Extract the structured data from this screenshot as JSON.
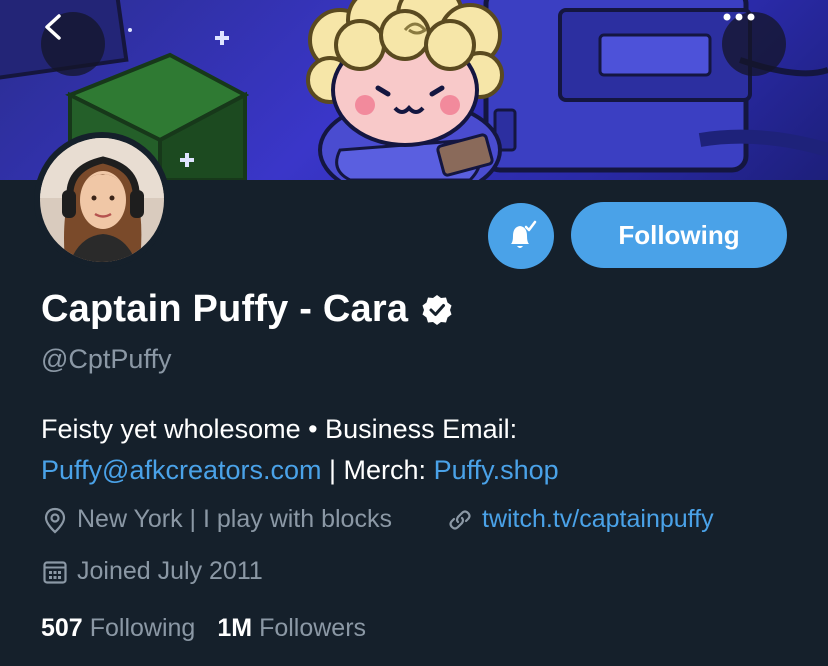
{
  "profile": {
    "name": "Captain Puffy - Cara",
    "handle": "@CptPuffy",
    "bio": {
      "line1": "Feisty yet wholesome • Business Email:",
      "email": "Puffy@afkcreators.com",
      "merch_sep": " | Merch: ",
      "merch_link": "Puffy.shop"
    },
    "location": "New York | I play with blocks",
    "website": "twitch.tv/captainpuffy",
    "joined": "Joined July 2011"
  },
  "actions": {
    "follow_label": "Following"
  },
  "stats": {
    "following_count": "507",
    "following_label": "Following",
    "followers_count": "1M",
    "followers_label": "Followers"
  },
  "colors": {
    "background": "#15202b",
    "accent": "#4aa2e8",
    "muted": "#8b98a5"
  },
  "icons": {
    "back": "back-arrow-icon",
    "more": "more-dots-icon",
    "notifications": "bell-check-icon",
    "verified": "verified-badge-icon",
    "location": "location-pin-icon",
    "link": "link-icon",
    "calendar": "calendar-icon"
  }
}
